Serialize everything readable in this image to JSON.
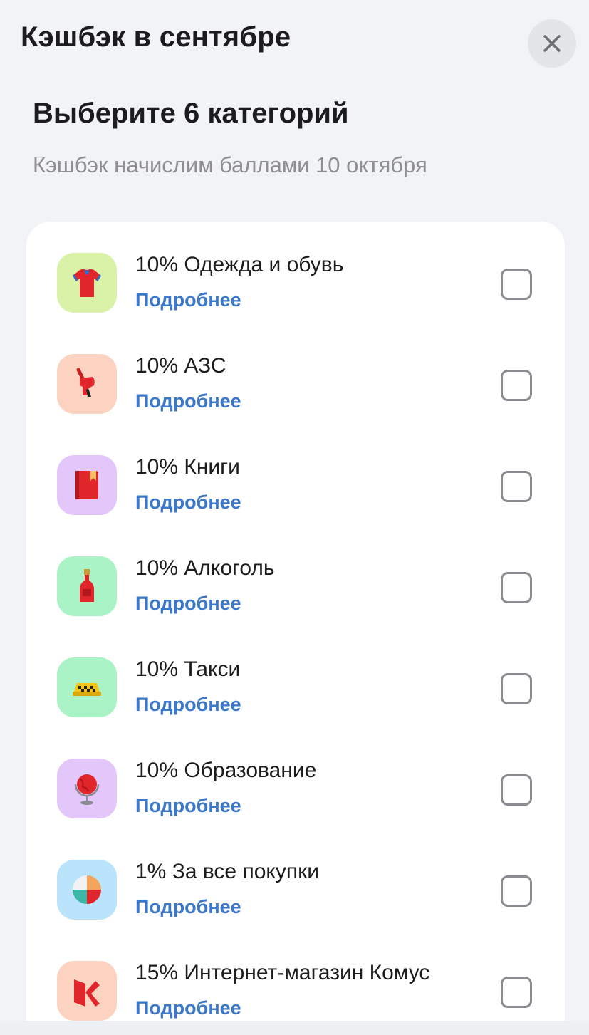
{
  "header": {
    "title": "Кэшбэк в сентябре",
    "close_icon": "close-icon"
  },
  "section": {
    "title": "Выберите 6 категорий",
    "subtitle": "Кэшбэк начислим баллами 10 октября"
  },
  "categories": [
    {
      "label": "10% Одежда и обувь",
      "link": "Подробнее",
      "icon": "tshirt-icon",
      "tile_color": "#d9f2a8",
      "checked": false
    },
    {
      "label": "10% АЗС",
      "link": "Подробнее",
      "icon": "fuel-nozzle-icon",
      "tile_color": "#fcd3c0",
      "checked": false
    },
    {
      "label": "10% Книги",
      "link": "Подробнее",
      "icon": "book-icon",
      "tile_color": "#e3c7fb",
      "checked": false
    },
    {
      "label": "10% Алкоголь",
      "link": "Подробнее",
      "icon": "bottle-icon",
      "tile_color": "#a9f3c6",
      "checked": false
    },
    {
      "label": "10% Такси",
      "link": "Подробнее",
      "icon": "taxi-sign-icon",
      "tile_color": "#a9f3c6",
      "checked": false
    },
    {
      "label": "10% Образование",
      "link": "Подробнее",
      "icon": "globe-icon",
      "tile_color": "#e3c7fb",
      "checked": false
    },
    {
      "label": "1% За все покупки",
      "link": "Подробнее",
      "icon": "pie-chart-icon",
      "tile_color": "#b9e4fb",
      "checked": false
    },
    {
      "label": "15% Интернет-магазин Комус",
      "link": "Подробнее",
      "icon": "komus-logo-icon",
      "tile_color": "#fcd3c0",
      "checked": false
    }
  ],
  "colors": {
    "link": "#3b78c9",
    "background": "#f1f3f6",
    "card": "#ffffff"
  }
}
